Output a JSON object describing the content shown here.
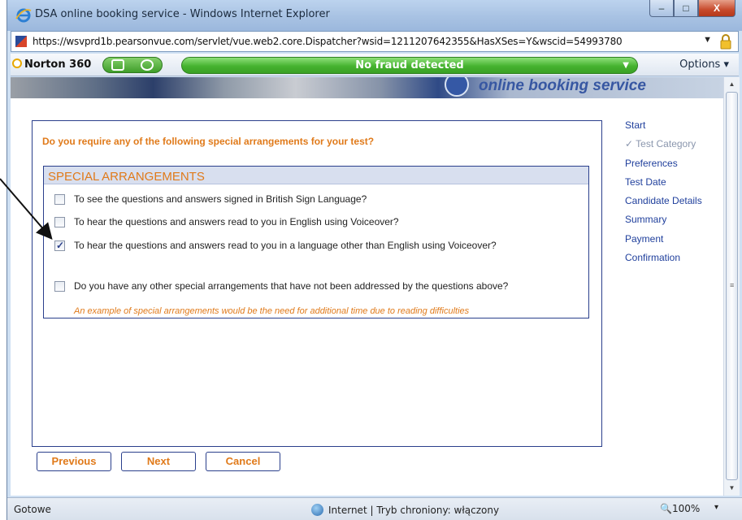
{
  "window": {
    "title": "DSA online booking service - Windows Internet Explorer",
    "minimize_label": "–",
    "maximize_label": "□",
    "close_label": "X"
  },
  "address_bar": {
    "url": "https://wsvprd1b.pearsonvue.com/servlet/vue.web2.core.Dispatcher?wsid=1211207642355&HasXSes=Y&wscid=54993780"
  },
  "norton": {
    "logo": "Norton 360",
    "status": "No fraud detected",
    "options": "Options ▾"
  },
  "banner": {
    "text": "online booking service"
  },
  "page": {
    "question": "Do you require any of the following special arrangements for your test?",
    "section_title": "SPECIAL ARRANGEMENTS",
    "options": [
      {
        "label": "To see the questions and answers signed in British Sign Language?",
        "checked": false
      },
      {
        "label": "To hear the questions and answers read to you in English using Voiceover?",
        "checked": false
      },
      {
        "label": "To hear the questions and answers read to you in a language other than English using Voiceover?",
        "checked": true
      },
      {
        "label": "Do you have any other special arrangements that have not been addressed by the questions above?",
        "checked": false
      }
    ],
    "hint": "An example of special arrangements would be the need for additional time due to reading difficulties",
    "buttons": {
      "previous": "Previous",
      "next": "Next",
      "cancel": "Cancel"
    }
  },
  "steps": [
    {
      "label": "Start",
      "done": false
    },
    {
      "label": "✓ Test Category",
      "done": true
    },
    {
      "label": "Preferences",
      "done": false
    },
    {
      "label": "Test Date",
      "done": false
    },
    {
      "label": "Candidate Details",
      "done": false
    },
    {
      "label": "Summary",
      "done": false
    },
    {
      "label": "Payment",
      "done": false
    },
    {
      "label": "Confirmation",
      "done": false
    }
  ],
  "status_bar": {
    "left": "Gotowe",
    "zone": "Internet | Tryb chroniony: włączony",
    "zoom": "🔍100%",
    "zoom_dropdown": "▾"
  },
  "colors": {
    "accent_orange": "#e07a1a",
    "link_blue": "#1f3f9c",
    "panel_border": "#2a3f8c",
    "norton_green": "#45b32f"
  }
}
